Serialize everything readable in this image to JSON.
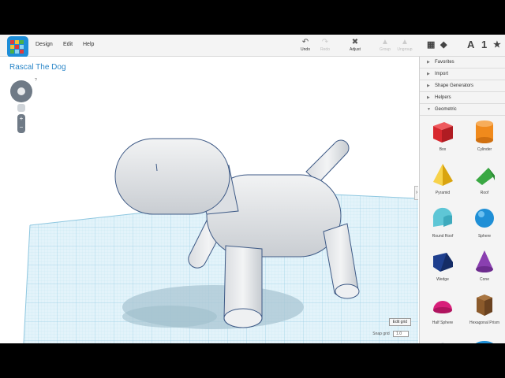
{
  "app": {
    "project_title": "Rascal The Dog",
    "menu": [
      "Design",
      "Edit",
      "Help"
    ],
    "toolbar": {
      "undo": "Undo",
      "redo": "Redo",
      "adjust": "Adjust",
      "group": "Group",
      "ungroup": "Ungroup"
    },
    "right_tools": [
      "A",
      "1"
    ]
  },
  "viewport": {
    "help_mark": "?",
    "zoom_in": "+",
    "zoom_out": "−",
    "edit_grid": "Edit grid",
    "snap_label": "Snap grid",
    "snap_value": "1.0",
    "collapse_glyph": "›"
  },
  "panel": {
    "sections": [
      {
        "label": "Favorites",
        "open": false
      },
      {
        "label": "Import",
        "open": false
      },
      {
        "label": "Shape Generators",
        "open": false
      },
      {
        "label": "Helpers",
        "open": false
      },
      {
        "label": "Geometric",
        "open": true
      }
    ],
    "shapes": [
      {
        "label": "Box",
        "icon": "box-icon",
        "color": "#d8282e"
      },
      {
        "label": "Cylinder",
        "icon": "cylinder-icon",
        "color": "#f08a1c"
      },
      {
        "label": "Pyramid",
        "icon": "pyramid-icon",
        "color": "#f2c21a"
      },
      {
        "label": "Roof",
        "icon": "roof-icon",
        "color": "#3aa843"
      },
      {
        "label": "Round Roof",
        "icon": "round-roof-icon",
        "color": "#5ec6d6"
      },
      {
        "label": "Sphere",
        "icon": "sphere-icon",
        "color": "#1f8fd6"
      },
      {
        "label": "Wedge",
        "icon": "wedge-icon",
        "color": "#1e3f8e"
      },
      {
        "label": "Cone",
        "icon": "cone-icon",
        "color": "#8a3fb0"
      },
      {
        "label": "Half Sphere",
        "icon": "half-sphere-icon",
        "color": "#d81f7a"
      },
      {
        "label": "Hexagonal Prism",
        "icon": "hexagonal-prism-icon",
        "color": "#8b5a2b"
      }
    ]
  },
  "colors": {
    "accent": "#2a86c8",
    "grid": "#cfeaf5",
    "model": "#e4e6e8"
  }
}
